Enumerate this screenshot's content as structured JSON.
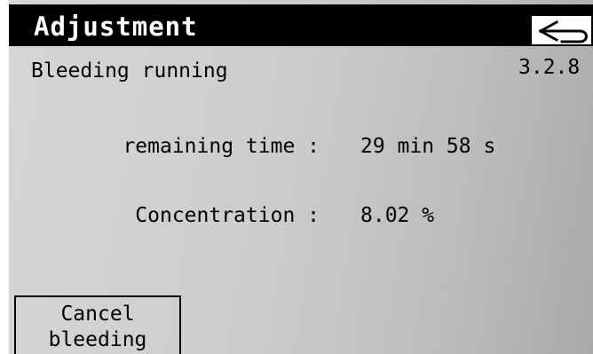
{
  "header": {
    "title": "Adjustment",
    "back_icon": "back-arrow-icon"
  },
  "status": {
    "text": "Bleeding running",
    "screen_code": "3.2.8"
  },
  "readouts": [
    {
      "label": "remaining time :",
      "value": "29 min 58 s"
    },
    {
      "label": "Concentration :",
      "value": "8.02 %"
    }
  ],
  "actions": {
    "cancel_line1": "Cancel",
    "cancel_line2": "bleeding"
  },
  "colors": {
    "title_bar": "#000000",
    "title_text": "#ffffff",
    "background": "#cdcdcd"
  }
}
